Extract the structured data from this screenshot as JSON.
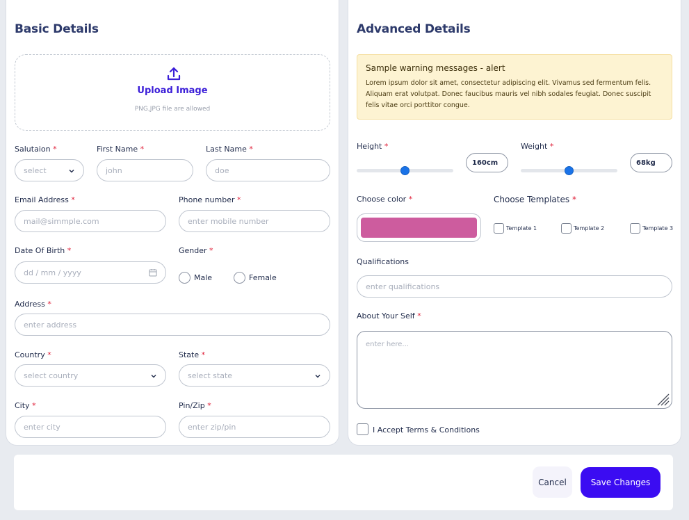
{
  "basic": {
    "title": "Basic Details",
    "upload": {
      "label": "Upload Image",
      "hint": "PNG,JPG file are allowed"
    },
    "salutation": {
      "label": "Salutaion",
      "placeholder": "select"
    },
    "first_name": {
      "label": "First Name",
      "placeholder": "john"
    },
    "last_name": {
      "label": "Last Name",
      "placeholder": "doe"
    },
    "email": {
      "label": "Email Address",
      "placeholder": "mail@simmple.com"
    },
    "phone": {
      "label": "Phone number",
      "placeholder": "enter mobile number"
    },
    "dob": {
      "label": "Date Of Birth",
      "placeholder": "dd / mm / yyyy"
    },
    "gender": {
      "label": "Gender",
      "options": [
        "Male",
        "Female"
      ]
    },
    "address": {
      "label": "Address",
      "placeholder": "enter address"
    },
    "country": {
      "label": "Country",
      "placeholder": "select country"
    },
    "state": {
      "label": "State",
      "placeholder": "select state"
    },
    "city": {
      "label": "City",
      "placeholder": "enter city"
    },
    "pin": {
      "label": "Pin/Zip",
      "placeholder": "enter zip/pin"
    },
    "required_mark": "*"
  },
  "advanced": {
    "title": "Advanced Details",
    "alert": {
      "title": "Sample warning messages - alert",
      "body": "Lorem ipsum dolor sit amet, consectetur adipiscing elit. Vivamus sed fermentum felis. Aliquam erat volutpat. Donec faucibus mauris vel nibh sodales feugiat. Donec suscipit felis vitae orci porttitor congue."
    },
    "height": {
      "label": "Height",
      "value": "160cm",
      "slider_fraction": 0.5
    },
    "weight": {
      "label": "Weight",
      "value": "68kg",
      "slider_fraction": 0.5
    },
    "color": {
      "label": "Choose color",
      "value": "#cd5c9e"
    },
    "templates": {
      "label": "Choose Templates",
      "options": [
        "Template 1",
        "Template 2",
        "Template 3"
      ]
    },
    "qualifications": {
      "label": "Qualifications",
      "placeholder": "enter qualifications"
    },
    "about": {
      "label": "About Your Self",
      "placeholder": "enter here..."
    },
    "terms": {
      "label": "I Accept Terms & Conditions"
    },
    "required_mark": "*"
  },
  "footer": {
    "cancel_label": "Cancel",
    "save_label": "Save Changes"
  },
  "colors": {
    "accent": "#3b0cf2",
    "upload_text": "#3b1ed8",
    "required": "#e0213a",
    "slider": "#1a73e8"
  }
}
